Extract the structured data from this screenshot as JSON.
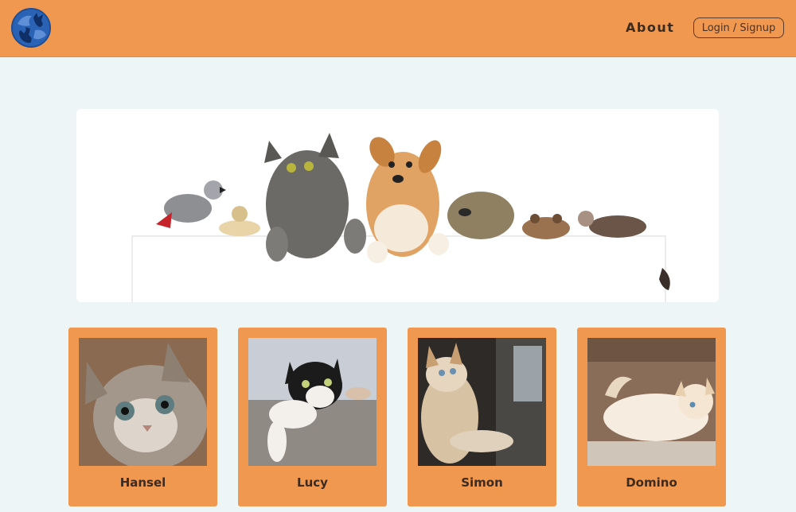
{
  "header": {
    "logo_icon": "globe-pet-logo-icon",
    "nav_about": "About",
    "login_label": "Login / Signup",
    "accent_color": "#f0984f"
  },
  "hero": {
    "image": "pets-peeking-over-banner"
  },
  "pets": [
    {
      "name": "Hansel",
      "image": "tabby-kitten"
    },
    {
      "name": "Lucy",
      "image": "black-white-cat"
    },
    {
      "name": "Simon",
      "image": "cream-cat-by-window"
    },
    {
      "name": "Domino",
      "image": "white-cat-lying"
    }
  ]
}
